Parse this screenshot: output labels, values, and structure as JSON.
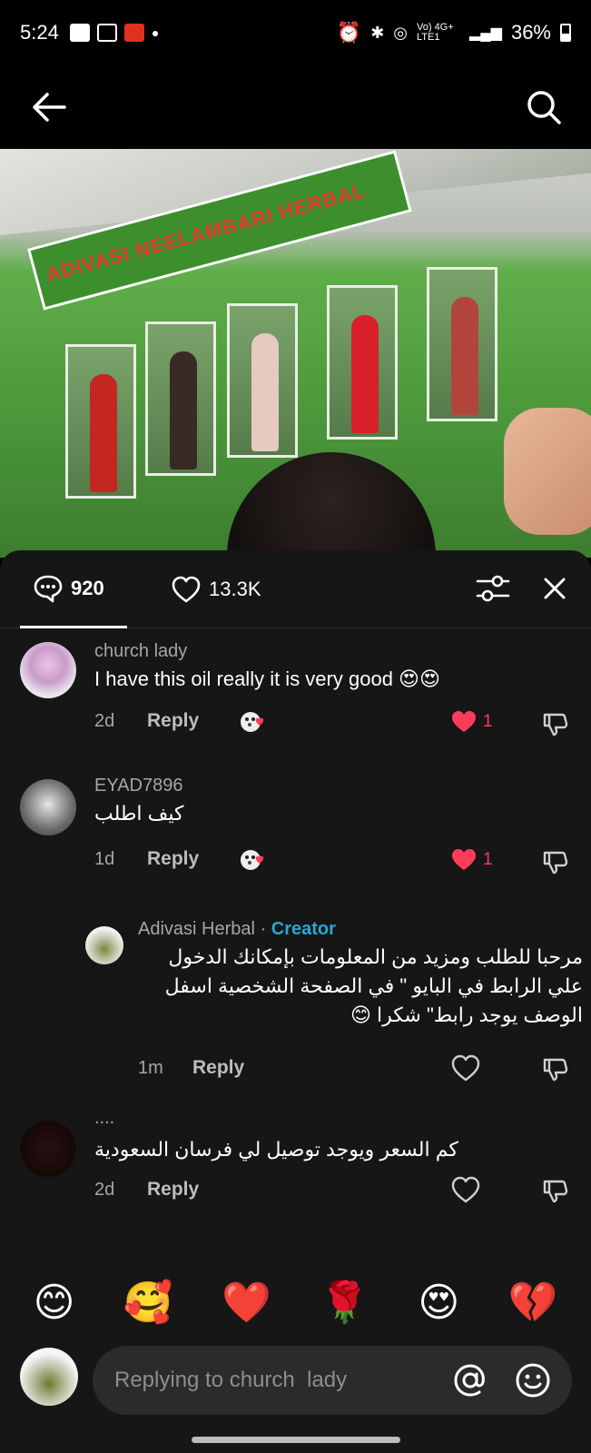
{
  "status_bar": {
    "time": "5:24",
    "network": "Vo) 4G+ LTE1",
    "battery": "36%"
  },
  "video": {
    "banner_text": "ADIVASI NEELAMBARI HERBAL"
  },
  "sheet": {
    "comments_count": "920",
    "likes_count": "13.3K"
  },
  "comments": [
    {
      "user": "church  lady",
      "text": "I have this oil really it is very good 😍😍",
      "age": "2d",
      "reply_label": "Reply",
      "likes": "1"
    },
    {
      "user": "EYAD7896",
      "text": "كيف اطلب",
      "age": "1d",
      "reply_label": "Reply",
      "likes": "1"
    },
    {
      "user": "Adivasi Herbal",
      "separator": "·",
      "badge": "Creator",
      "text": "مرحبا للطلب ومزيد من المعلومات بإمكانك الدخول علي الرابط في البايو \" في الصفحة الشخصية اسفل الوصف يوجد رابط\" شكرا 😊",
      "age": "1m",
      "reply_label": "Reply"
    },
    {
      "user": "....",
      "text": "كم السعر ويوجد توصيل لي فرسان السعودية",
      "age": "2d",
      "reply_label": "Reply"
    }
  ],
  "emoji_bar": [
    "😊",
    "🥰",
    "❤️",
    "🌹",
    "😍",
    "💔"
  ],
  "input": {
    "placeholder": "Replying to church  lady"
  },
  "colors": {
    "sheet_bg": "#161616",
    "creator_badge": "#29a7d3",
    "like_red": "#ff3b5c"
  }
}
